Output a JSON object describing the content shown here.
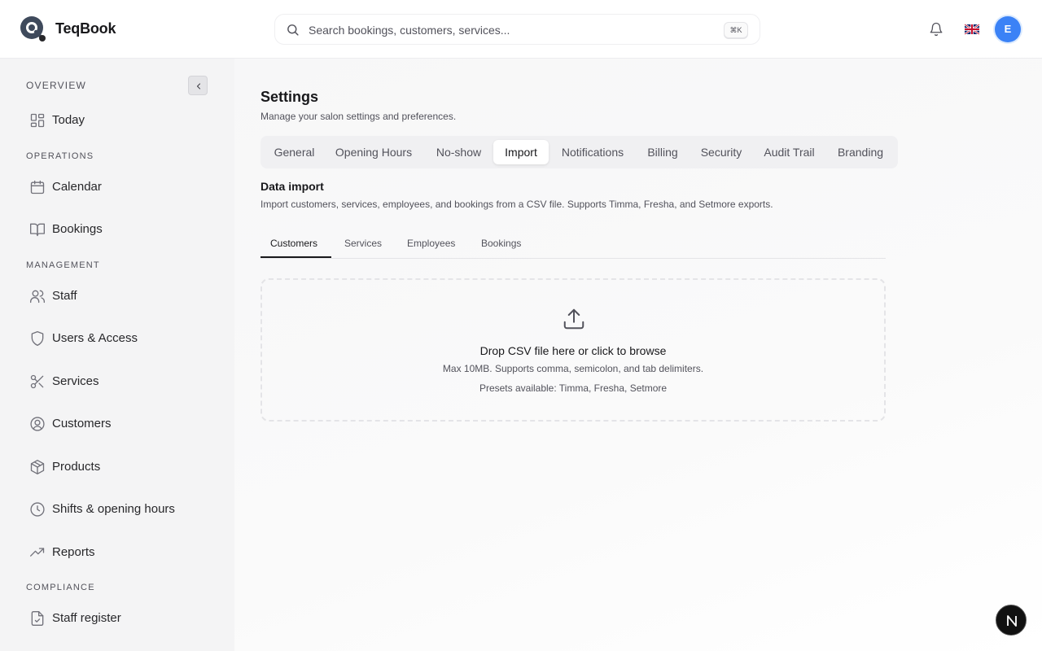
{
  "header": {
    "brand": "TeqBook",
    "search_placeholder": "Search bookings, customers, services...",
    "search_shortcut": "⌘K",
    "avatar_initial": "E",
    "icons": {
      "logo": "teqbook-logo",
      "search": "search-icon",
      "notifications": "bell-icon",
      "language": "uk-flag-icon"
    }
  },
  "sidebar": {
    "sections": {
      "overview": "OVERVIEW",
      "operations": "OPERATIONS",
      "management": "MANAGEMENT",
      "compliance": "COMPLIANCE"
    },
    "items": {
      "today": "Today",
      "calendar": "Calendar",
      "bookings": "Bookings",
      "staff": "Staff",
      "users_access": "Users & Access",
      "services": "Services",
      "customers": "Customers",
      "products": "Products",
      "shifts": "Shifts & opening hours",
      "reports": "Reports",
      "staff_register": "Staff register"
    }
  },
  "main": {
    "title": "Settings",
    "subtitle": "Manage your salon settings and preferences.",
    "tabs": {
      "general": "General",
      "opening_hours": "Opening Hours",
      "no_show": "No-show",
      "import": "Import",
      "notifications": "Notifications",
      "billing": "Billing",
      "security": "Security",
      "audit_trail": "Audit Trail",
      "branding": "Branding"
    },
    "active_tab": "Import",
    "section": {
      "title": "Data import",
      "description": "Import customers, services, employees, and bookings from a CSV file. Supports Timma, Fresha, and Setmore exports."
    },
    "subtabs": {
      "customers": "Customers",
      "services": "Services",
      "employees": "Employees",
      "bookings": "Bookings"
    },
    "active_subtab": "Customers",
    "dropzone": {
      "title": "Drop CSV file here or click to browse",
      "limits": "Max 10MB. Supports comma, semicolon, and tab delimiters.",
      "presets": "Presets available: Timma, Fresha, Setmore"
    }
  },
  "colors": {
    "accent": "#3b82f6",
    "sidebar_bg": "#f4f4f5",
    "text": "#18181b",
    "muted": "#52525b"
  }
}
